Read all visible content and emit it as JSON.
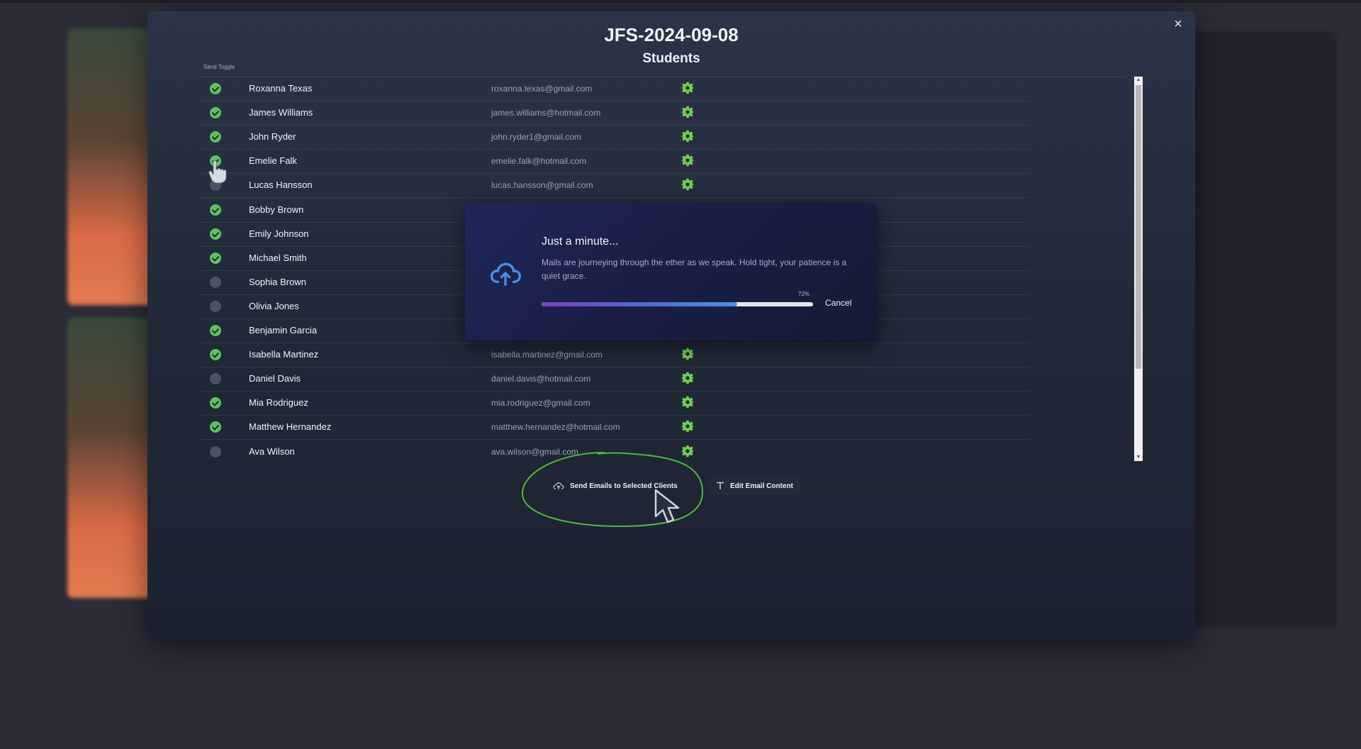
{
  "modal": {
    "title": "JFS-2024-09-08",
    "subtitle": "Students",
    "close_icon": "×",
    "column_header": "Send Toggle"
  },
  "students": [
    {
      "name": "Roxanna Texas",
      "email": "roxanna.texas@gmail.com",
      "selected": true
    },
    {
      "name": "James Williams",
      "email": "james.williams@hotmail.com",
      "selected": true
    },
    {
      "name": "John Ryder",
      "email": "john.ryder1@gmail.com",
      "selected": true
    },
    {
      "name": "Emelie Falk",
      "email": "emelie.falk@hotmail.com",
      "selected": true
    },
    {
      "name": "Lucas Hansson",
      "email": "lucas.hansson@gmail.com",
      "selected": false
    },
    {
      "name": "Bobby Brown",
      "email": "",
      "selected": true
    },
    {
      "name": "Emily Johnson",
      "email": "",
      "selected": true
    },
    {
      "name": "Michael Smith",
      "email": "",
      "selected": true
    },
    {
      "name": "Sophia Brown",
      "email": "",
      "selected": false
    },
    {
      "name": "Olivia Jones",
      "email": "",
      "selected": false
    },
    {
      "name": "Benjamin Garcia",
      "email": "",
      "selected": true
    },
    {
      "name": "Isabella Martinez",
      "email": "isabella.martinez@gmail.com",
      "selected": true
    },
    {
      "name": "Daniel Davis",
      "email": "daniel.davis@hotmail.com",
      "selected": false
    },
    {
      "name": "Mia Rodriguez",
      "email": "mia.rodriguez@gmail.com",
      "selected": true
    },
    {
      "name": "Matthew Hernandez",
      "email": "matthew.hernandez@hotmail.com",
      "selected": true
    },
    {
      "name": "Ava Wilson",
      "email": "ava.wilson@gmail.com",
      "selected": false
    }
  ],
  "actions": {
    "send_label": "Send Emails to Selected Clients",
    "edit_label": "Edit Email Content"
  },
  "progress_dialog": {
    "title": "Just a minute...",
    "message": "Mails are journeying through the ether as we speak. Hold tight, your patience is a quiet grace.",
    "percent_label": "72%",
    "progress": 0.72,
    "cancel_label": "Cancel"
  },
  "colors": {
    "toggle_on": "#5cc25c",
    "toggle_off": "#4b5263",
    "gear": "#6ed24a",
    "cloud": "#4b8ee8",
    "annotation": "#4cba3c"
  },
  "icons": {
    "toggle": "check-circle-icon",
    "row_action": "gear-icon",
    "send": "cloud-upload-icon",
    "edit": "text-icon",
    "dialog": "cloud-upload-icon"
  }
}
